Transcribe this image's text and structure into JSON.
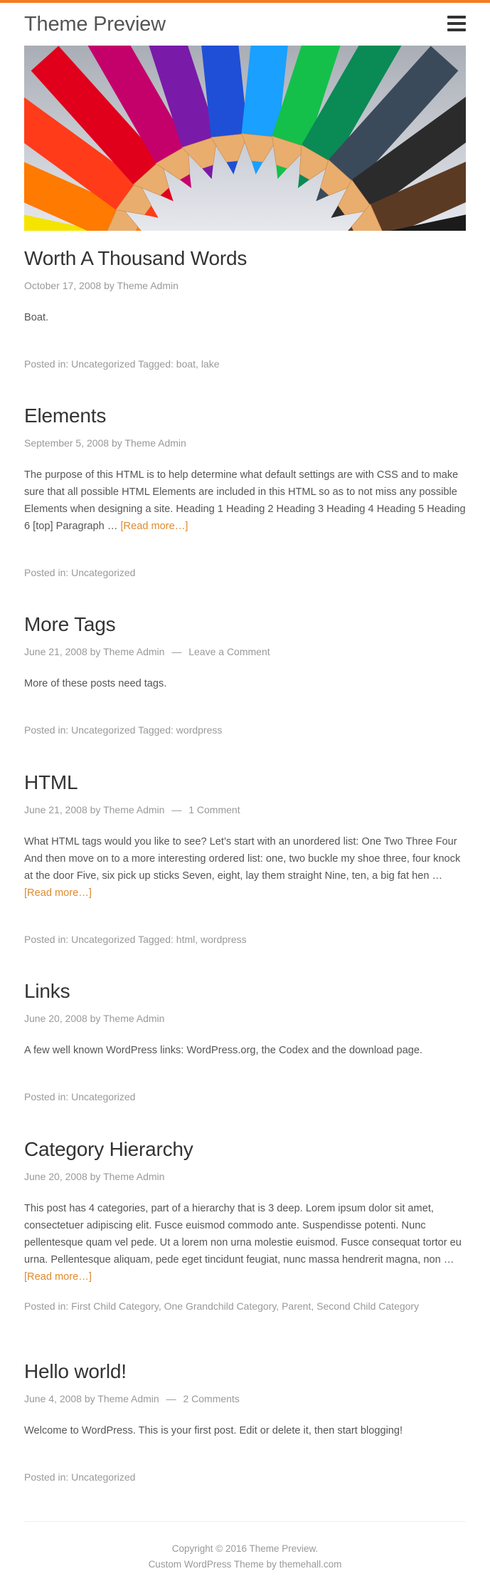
{
  "site": {
    "title": "Theme Preview"
  },
  "colors": {
    "accent": "#f47c20",
    "link": "#e08a2e"
  },
  "header": {
    "menu_icon": "hamburger-menu-icon"
  },
  "posts": [
    {
      "title": "Worth A Thousand Words",
      "date": "October 17, 2008",
      "by": "by",
      "author": "Theme Admin",
      "comments": "",
      "excerpt": "Boat.",
      "read_more": "",
      "posted_in_label": "Posted in:",
      "categories": "Uncategorized",
      "tagged_label": "Tagged:",
      "tags": "boat, lake"
    },
    {
      "title": "Elements",
      "date": "September 5, 2008",
      "by": "by",
      "author": "Theme Admin",
      "comments": "",
      "excerpt": "The purpose of this HTML is to help determine what default settings are with CSS and to make sure that all possible HTML Elements are included in this HTML so as to not miss any possible Elements when designing a site. Heading 1 Heading 2 Heading 3 Heading 4 Heading 5 Heading 6 [top] Paragraph …",
      "read_more": "[Read more…]",
      "posted_in_label": "Posted in:",
      "categories": "Uncategorized",
      "tagged_label": "",
      "tags": ""
    },
    {
      "title": "More Tags",
      "date": "June 21, 2008",
      "by": "by",
      "author": "Theme Admin",
      "comments": "Leave a Comment",
      "excerpt": "More of these posts need tags.",
      "read_more": "",
      "posted_in_label": "Posted in:",
      "categories": "Uncategorized",
      "tagged_label": "Tagged:",
      "tags": "wordpress"
    },
    {
      "title": "HTML",
      "date": "June 21, 2008",
      "by": "by",
      "author": "Theme Admin",
      "comments": "1 Comment",
      "excerpt": "What HTML tags would you like to see? Let’s start with an unordered list: One Two Three Four And then move on to a more interesting ordered list: one, two buckle my shoe three, four knock at the door Five, six pick up sticks Seven, eight, lay them straight Nine, ten, a big fat hen …",
      "read_more": "[Read more…]",
      "posted_in_label": "Posted in:",
      "categories": "Uncategorized",
      "tagged_label": "Tagged:",
      "tags": "html, wordpress"
    },
    {
      "title": "Links",
      "date": "June 20, 2008",
      "by": "by",
      "author": "Theme Admin",
      "comments": "",
      "excerpt": "A few well known WordPress links: WordPress.org, the Codex and the download page.",
      "read_more": "",
      "posted_in_label": "Posted in:",
      "categories": "Uncategorized",
      "tagged_label": "",
      "tags": ""
    },
    {
      "title": "Category Hierarchy",
      "date": "June 20, 2008",
      "by": "by",
      "author": "Theme Admin",
      "comments": "",
      "excerpt": "This post has 4 categories, part of a hierarchy that is 3 deep. Lorem ipsum dolor sit amet, consectetuer adipiscing elit. Fusce euismod commodo ante. Suspendisse potenti. Nunc pellentesque quam vel pede. Ut a lorem non urna molestie euismod. Fusce consequat tortor eu urna. Pellentesque aliquam, pede eget tincidunt feugiat, nunc massa hendrerit magna, non …",
      "read_more": "[Read more…]",
      "posted_in_label": "Posted in:",
      "categories": "First Child Category, One Grandchild Category, Parent, Second Child Category",
      "tagged_label": "",
      "tags": ""
    },
    {
      "title": "Hello world!",
      "date": "June 4, 2008",
      "by": "by",
      "author": "Theme Admin",
      "comments": "2 Comments",
      "excerpt": "Welcome to WordPress. This is your first post. Edit or delete it, then start blogging!",
      "read_more": "",
      "posted_in_label": "Posted in:",
      "categories": "Uncategorized",
      "tagged_label": "",
      "tags": ""
    }
  ],
  "footer": {
    "copyright": "Copyright © 2016 Theme Preview.",
    "credit": "Custom WordPress Theme by themehall.com"
  }
}
